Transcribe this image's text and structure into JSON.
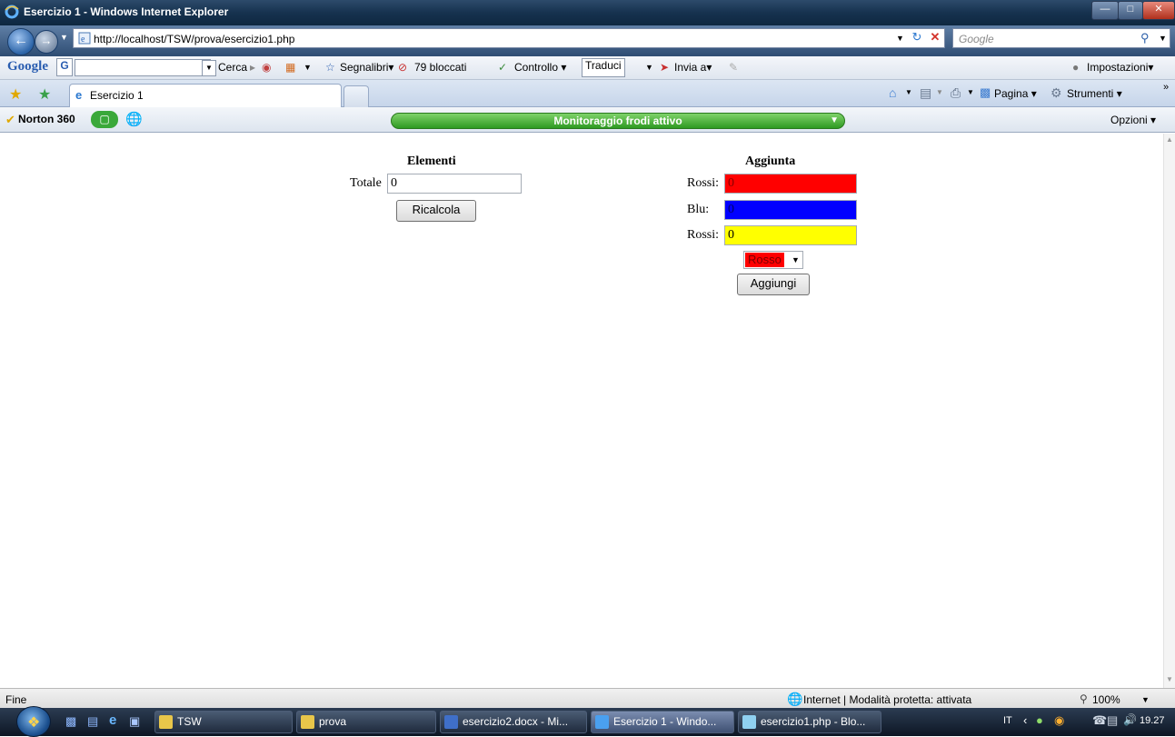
{
  "window": {
    "title": "Esercizio 1 - Windows Internet Explorer"
  },
  "address": {
    "url": "http://localhost/TSW/prova/esercizio1.php",
    "search_placeholder": "Google"
  },
  "google_toolbar": {
    "logo": "Google",
    "search": "Cerca",
    "bookmarks": "Segnalibri",
    "blocked": "79 bloccati",
    "check": "Controllo",
    "translate": "Traduci",
    "send": "Invia a",
    "settings": "Impostazioni"
  },
  "tabs": {
    "active": "Esercizio 1"
  },
  "command_bar": {
    "page": "Pagina",
    "tools": "Strumenti"
  },
  "norton": {
    "brand": "Norton 360",
    "fraud": "Monitoraggio frodi attivo",
    "options": "Opzioni"
  },
  "page": {
    "elementi": {
      "heading": "Elementi",
      "total_label": "Totale",
      "total_value": "0",
      "recalc_button": "Ricalcola"
    },
    "aggiunta": {
      "heading": "Aggiunta",
      "rows": [
        {
          "label": "Rossi:",
          "value": "0",
          "color": "#ff0000"
        },
        {
          "label": "Blu:",
          "value": "0",
          "color": "#0000ff"
        },
        {
          "label": "Rossi:",
          "value": "0",
          "color": "#ffff00"
        }
      ],
      "select_value": "Rosso",
      "select_color": "#ff0000",
      "add_button": "Aggiungi"
    }
  },
  "status": {
    "left": "Fine",
    "zone": "Internet | Modalità protetta: attivata",
    "zoom": "100%"
  },
  "taskbar": {
    "items": [
      {
        "label": "TSW"
      },
      {
        "label": "prova"
      },
      {
        "label": "esercizio2.docx - Mi..."
      },
      {
        "label": "Esercizio 1 - Windo..."
      },
      {
        "label": "esercizio1.php - Blo..."
      }
    ],
    "lang": "IT",
    "clock": "19.27"
  }
}
